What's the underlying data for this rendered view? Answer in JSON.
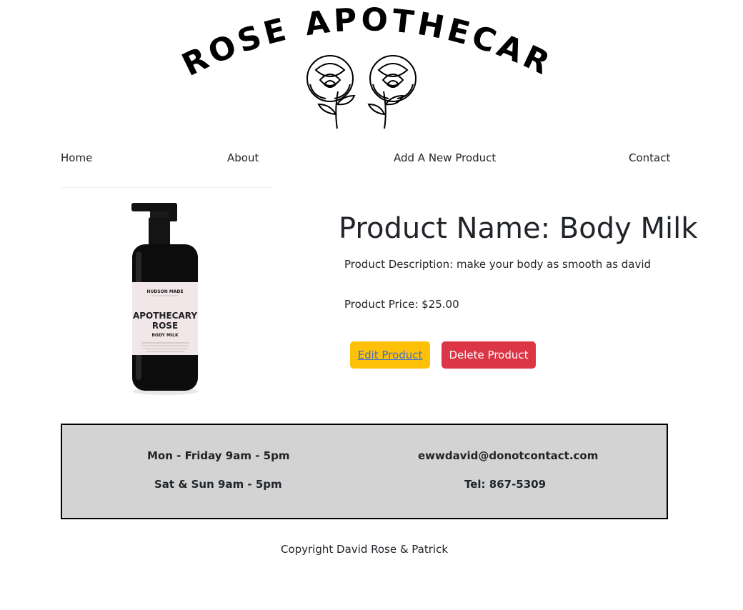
{
  "brand": {
    "name": "ROSE APOTHECARY",
    "word1": "ROSE",
    "word2": "APOTHECARY"
  },
  "nav": {
    "home": "Home",
    "about": "About",
    "add_product": "Add A New Product",
    "contact": "Contact"
  },
  "product": {
    "title": "Product Name: Body Milk",
    "description": "Product Description: make your body as smooth as david",
    "price": "Product Price: $25.00",
    "image_label": {
      "maker": "HUDSON MADE",
      "line1": "APOTHECARY",
      "line2": "ROSE",
      "line3": "BODY MILK"
    }
  },
  "actions": {
    "edit": "Edit Product",
    "delete": "Delete Product"
  },
  "footer": {
    "hours_weekday": "Mon - Friday 9am - 5pm",
    "hours_weekend": "Sat & Sun 9am - 5pm",
    "email": "ewwdavid@donotcontact.com",
    "phone": "Tel: 867-5309",
    "copyright": "Copyright David Rose & Patrick"
  },
  "colors": {
    "edit_button": "#ffc107",
    "delete_button": "#dc3545",
    "info_bg": "#d3d3d3"
  }
}
